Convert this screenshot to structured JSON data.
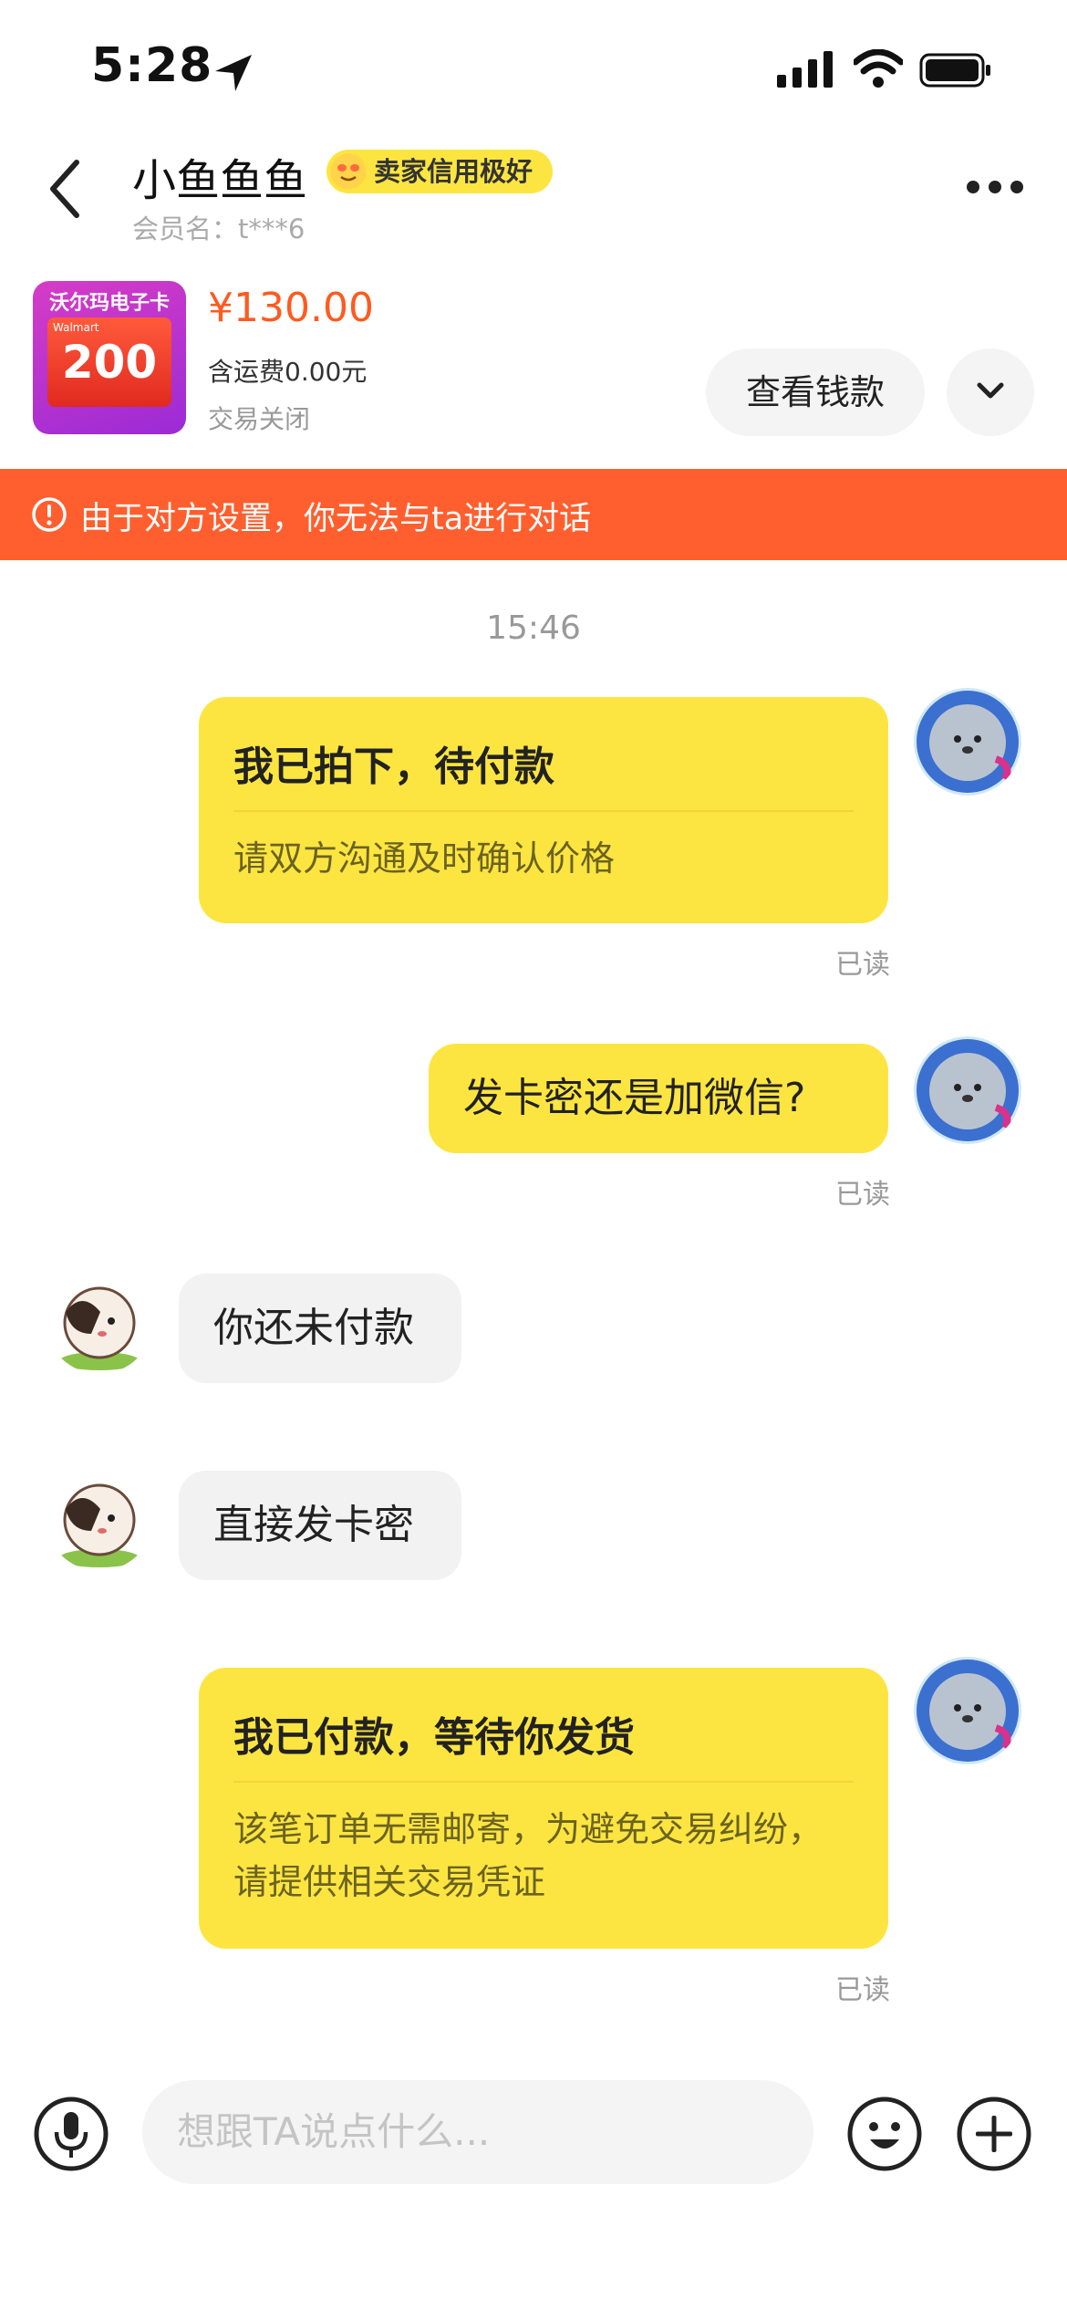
{
  "status_bar": {
    "time": "5:28"
  },
  "header": {
    "nickname": "小鱼鱼鱼",
    "credit_badge": "卖家信用极好",
    "member_name": "会员名：t***6"
  },
  "product": {
    "image_title": "沃尔玛电子卡",
    "image_brand": "Walmart",
    "image_value": "200",
    "price": "¥130.00",
    "shipping": "含运费0.00元",
    "status": "交易关闭",
    "view_money_label": "查看钱款"
  },
  "banner": {
    "text": "由于对方设置，你无法与ta进行对话"
  },
  "chat": {
    "timestamp": "15:46",
    "messages": [
      {
        "title": "我已拍下，待付款",
        "desc": "请双方沟通及时确认价格",
        "read": "已读"
      },
      {
        "text": "发卡密还是加微信?",
        "read": "已读"
      },
      {
        "text": "你还未付款"
      },
      {
        "text": "直接发卡密"
      },
      {
        "title": "我已付款，等待你发货",
        "desc": "该笔订单无需邮寄，为避免交易纠纷，请提供相关交易凭证",
        "read": "已读"
      }
    ]
  },
  "input": {
    "placeholder": "想跟TA说点什么..."
  },
  "colors": {
    "accent_yellow": "#fde541",
    "banner_orange": "#ff5f2e",
    "price_orange": "#ff5a1f"
  }
}
